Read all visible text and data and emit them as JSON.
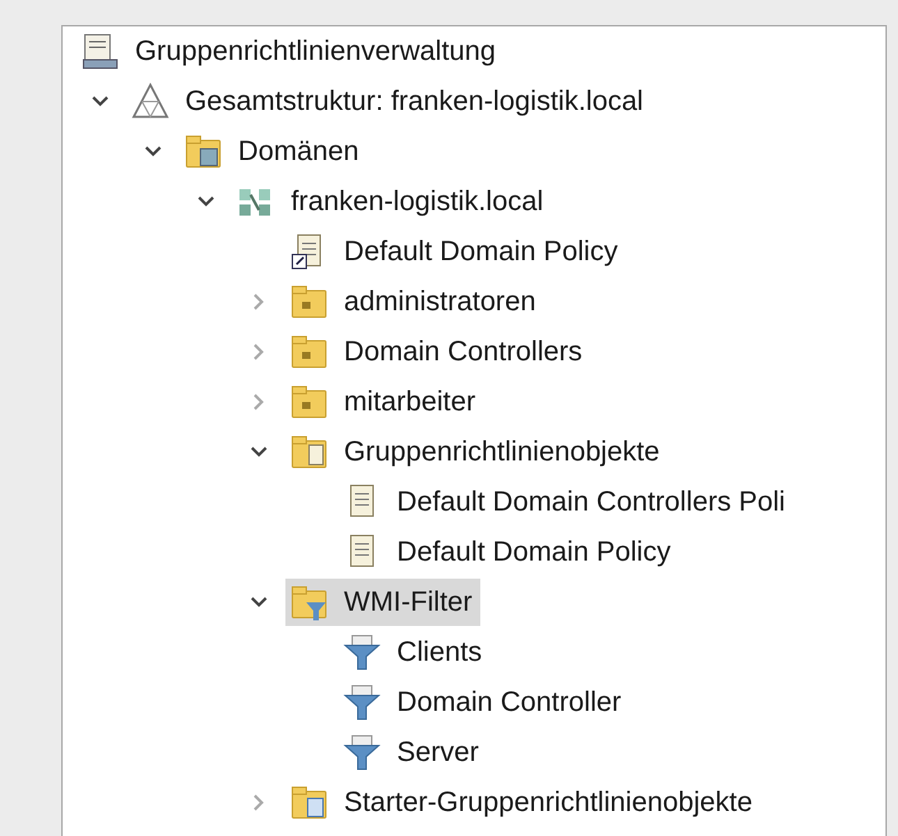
{
  "tree": [
    {
      "label": "Gruppenrichtlinienverwaltung",
      "kind": "console",
      "selected": false,
      "children": [
        {
          "label": "Gesamtstruktur: franken-logistik.local",
          "kind": "forest",
          "expanded": true,
          "selected": false,
          "children": [
            {
              "label": "Domänen",
              "kind": "domains",
              "expanded": true,
              "selected": false,
              "children": [
                {
                  "label": "franken-logistik.local",
                  "kind": "domain",
                  "expanded": true,
                  "selected": false,
                  "children": [
                    {
                      "label": "Default Domain Policy",
                      "kind": "gpo-link",
                      "selected": false
                    },
                    {
                      "label": "administratoren",
                      "kind": "ou",
                      "expanded": false,
                      "selected": false
                    },
                    {
                      "label": "Domain Controllers",
                      "kind": "ou",
                      "expanded": false,
                      "selected": false
                    },
                    {
                      "label": "mitarbeiter",
                      "kind": "ou",
                      "expanded": false,
                      "selected": false
                    },
                    {
                      "label": "Gruppenrichtlinienobjekte",
                      "kind": "gpo-folder",
                      "expanded": true,
                      "selected": false,
                      "children": [
                        {
                          "label": "Default Domain Controllers Poli",
                          "kind": "gpo",
                          "selected": false
                        },
                        {
                          "label": "Default Domain Policy",
                          "kind": "gpo",
                          "selected": false
                        }
                      ]
                    },
                    {
                      "label": "WMI-Filter",
                      "kind": "wmi-folder",
                      "expanded": true,
                      "selected": true,
                      "children": [
                        {
                          "label": "Clients",
                          "kind": "wmi",
                          "selected": false
                        },
                        {
                          "label": "Domain Controller",
                          "kind": "wmi",
                          "selected": false
                        },
                        {
                          "label": "Server",
                          "kind": "wmi",
                          "selected": false
                        }
                      ]
                    },
                    {
                      "label": "Starter-Gruppenrichtlinienobjekte",
                      "kind": "starter-folder",
                      "expanded": false,
                      "selected": false
                    }
                  ]
                }
              ]
            }
          ]
        }
      ]
    }
  ]
}
